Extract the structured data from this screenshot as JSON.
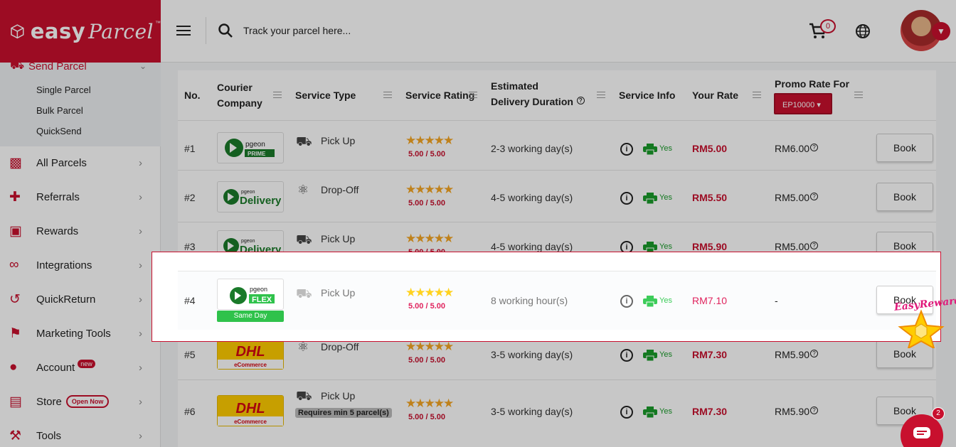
{
  "brand": {
    "logo_text": "easy",
    "logo_script": "Parcel",
    "tm": "™"
  },
  "header": {
    "search_placeholder": "Track your parcel here...",
    "cart_count": "0"
  },
  "sidebar": {
    "send_parcel": "Send Parcel",
    "sub_items": [
      "Single Parcel",
      "Bulk Parcel",
      "QuickSend"
    ],
    "items": [
      {
        "label": "All Parcels",
        "icon": "boxes-icon"
      },
      {
        "label": "Referrals",
        "icon": "users-plus-icon"
      },
      {
        "label": "Rewards",
        "icon": "gift-icon"
      },
      {
        "label": "Integrations",
        "icon": "link-icon"
      },
      {
        "label": "QuickReturn",
        "icon": "return-icon"
      },
      {
        "label": "Marketing Tools",
        "icon": "megaphone-icon"
      },
      {
        "label": "Account",
        "icon": "user-icon",
        "badge": "new"
      },
      {
        "label": "Store",
        "icon": "store-icon",
        "badge": "Open Now"
      },
      {
        "label": "Tools",
        "icon": "wrench-icon"
      }
    ]
  },
  "table": {
    "headers": {
      "no": "No.",
      "courier_1": "Courier",
      "courier_2": "Company",
      "service_type": "Service Type",
      "service_rating": "Service Rating",
      "duration_1": "Estimated",
      "duration_2": "Delivery Duration",
      "service_info": "Service Info",
      "your_rate": "Your Rate",
      "promo_rate": "Promo Rate For",
      "promo_code": "EP10000"
    },
    "rows": [
      {
        "no": "#1",
        "courier": "Pgeon Prime",
        "logo_top": "pgeon",
        "logo_bottom": "PRIME",
        "service": "Pick Up",
        "rating": "5.00 / 5.00",
        "duration": "2-3 working day(s)",
        "print": "Yes",
        "rate": "RM5.00",
        "promo": "RM6.00",
        "book": "Book"
      },
      {
        "no": "#2",
        "courier": "Pgeon Delivery",
        "logo_top": "pgeon",
        "logo_bottom": "Delivery",
        "service": "Drop-Off",
        "rating": "5.00 / 5.00",
        "duration": "4-5 working day(s)",
        "print": "Yes",
        "rate": "RM5.50",
        "promo": "RM5.00",
        "book": "Book"
      },
      {
        "no": "#3",
        "courier": "Pgeon Delivery",
        "logo_top": "pgeon",
        "logo_bottom": "Delivery",
        "service": "Pick Up",
        "rating": "5.00 / 5.00",
        "duration": "4-5 working day(s)",
        "print": "Yes",
        "rate": "RM5.90",
        "promo": "RM5.00",
        "book": "Book"
      },
      {
        "no": "#4",
        "courier": "Pgeon Flex",
        "logo_top": "pgeon",
        "logo_bottom": "FLEX",
        "tag": "Same Day",
        "service": "Pick Up",
        "rating": "5.00 / 5.00",
        "duration": "8 working hour(s)",
        "print": "Yes",
        "rate": "RM7.10",
        "promo": "-",
        "book": "Book"
      },
      {
        "no": "#5",
        "courier": "DHL eCommerce",
        "logo_top": "DHL",
        "logo_bottom": "eCommerce",
        "service": "Drop-Off",
        "rating": "5.00 / 5.00",
        "duration": "3-5 working day(s)",
        "print": "Yes",
        "rate": "RM7.30",
        "promo": "RM5.90",
        "book": "Book"
      },
      {
        "no": "#6",
        "courier": "DHL eCommerce",
        "logo_top": "DHL",
        "logo_bottom": "eCommerce",
        "service": "Pick Up",
        "chip": "Requires min 5 parcel(s)",
        "rating": "5.00 / 5.00",
        "duration": "3-5 working day(s)",
        "print": "Yes",
        "rate": "RM7.30",
        "promo": "RM5.90",
        "book": "Book"
      }
    ]
  },
  "widgets": {
    "reward_text": "EasyReward",
    "chat_count": "2"
  },
  "colors": {
    "brand": "#c8102e",
    "green": "#1a9c2b",
    "star": "#f5a623"
  }
}
